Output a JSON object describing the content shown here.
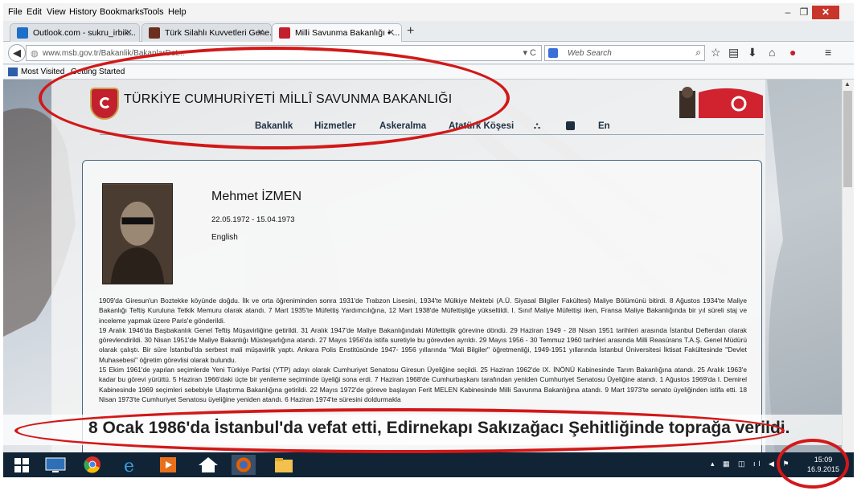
{
  "menubar": {
    "file": "File",
    "edit": "Edit",
    "view": "View",
    "history": "History",
    "bookmarks": "Bookmarks",
    "tools": "Tools",
    "help": "Help"
  },
  "window": {
    "minimize": "–",
    "restore": "❐",
    "close": "✕"
  },
  "tabs": [
    {
      "label": "Outlook.com - sukru_irbik...",
      "close": "✕",
      "color": "#1e6fc8"
    },
    {
      "label": "Türk Silahlı Kuvvetleri Gene...",
      "close": "✕",
      "color": "#6b2f20"
    },
    {
      "label": "Milli Savunma Bakanlığı • ...",
      "close": "✕",
      "color": "#c3202e"
    }
  ],
  "newtab": "+",
  "nav": {
    "url": "www.msb.gov.tr/Bakanlik/BakanlarDet...",
    "url_controls": "▾ C",
    "search_placeholder": "Web Search",
    "back": "◀"
  },
  "bookmarks": {
    "most_visited": "Most Visited",
    "getting_started": "Getting Started"
  },
  "site": {
    "title": "TÜRKİYE CUMHURİYETİ MİLLÎ SAVUNMA BAKANLIĞI",
    "nav": [
      "Bakanlık",
      "Hizmetler",
      "Askeralma",
      "Atatürk Köşesi",
      "En"
    ]
  },
  "person": {
    "name": "Mehmet İZMEN",
    "dates": "22.05.1972 - 15.04.1973",
    "lang": "English",
    "bio": [
      "1909'da Giresun'un Boztekke köyünde doğdu. İlk ve orta öğreniminden sonra 1931'de Trabzon Lisesini, 1934'te Mülkiye Mektebi (A.Ü. Siyasal Bilgiler Fakültesi) Maliye Bölümünü bitirdi. 8 Ağustos 1934'te Maliye Bakanlığı Teftiş Kuruluna Tetkik Memuru olarak atandı. 7 Mart 1935'te Müfettiş Yardımcılığına, 12 Mart 1938'de Müfettişliğe yükseltildi. I. Sınıf Maliye Müfettişi iken, Fransa Maliye Bakanlığında bir yıl süreli staj ve inceleme yapmak üzere Paris'e gönderildi.",
      "19 Aralık 1946'da Başbakanlık Genel Teftiş Müşavirliğine getirildi. 31 Aralık 1947'de Maliye Bakanlığındaki Müfettişlik görevine döndü. 29 Haziran 1949 - 28 Nisan 1951 tarihleri arasında İstanbul Defterdarı olarak görevlendirildi. 30 Nisan 1951'de Maliye Bakanlığı Müsteşarlığına atandı. 27 Mayıs 1956'da istifa suretiyle bu görevden ayrıldı. 29 Mayıs 1956 - 30 Temmuz 1960 tarihleri arasında Milli Reasürans T.A.Ş. Genel Müdürü olarak çalıştı. Bir süre İstanbul'da serbest mali müşavirlik yaptı. Ankara Polis Enstitüsünde 1947- 1956 yıllarında \"Mali Bilgiler\" öğretmenliği, 1949-1951 yıllarında İstanbul Üniversitesi İktisat Fakültesinde \"Devlet Muhasebesi\" öğretim görevlisi olarak bulundu.",
      "15 Ekim 1961'de yapılan seçimlerde Yeni Türkiye Partisi (YTP) adayı olarak Cumhuriyet Senatosu Giresun Üyeliğine seçildi. 25 Haziran 1962'de IX. İNÖNÜ Kabinesinde Tarım Bakanlığına atandı. 25 Aralık 1963'e kadar bu görevi yürüttü. 5 Haziran 1966'daki üçte bir yenileme seçiminde üyeliği sona erdi. 7 Haziran 1968'de Cumhurbaşkanı tarafından yeniden Cumhuriyet Senatosu Üyeliğine atandı. 1 Ağustos 1969'da I. Demirel Kabinesinde 1969 seçimleri sebebiyle Ulaştırma Bakanlığına getirildi. 22 Mayıs 1972'de göreve başlayan Ferit MELEN Kabinesinde Milli Savunma Bakanlığına atandı. 9 Mart 1973'te senato üyeliğinden istifa etti. 18 Nisan 1973'te Cumhuriyet Senatosu üyeliğine yeniden atandı. 6 Haziran 1974'te süresini doldurmakla"
    ],
    "death_caption": "8 Ocak 1986'da İstanbul'da vefat etti, Edirnekapı Sakızağacı Şehitliğinde toprağa verildi."
  },
  "clock": {
    "time": "15:09",
    "date": "16.9.2015"
  },
  "colors": {
    "annotation": "#d21818",
    "taskbar": "#102436",
    "brand_red": "#c3202e"
  }
}
